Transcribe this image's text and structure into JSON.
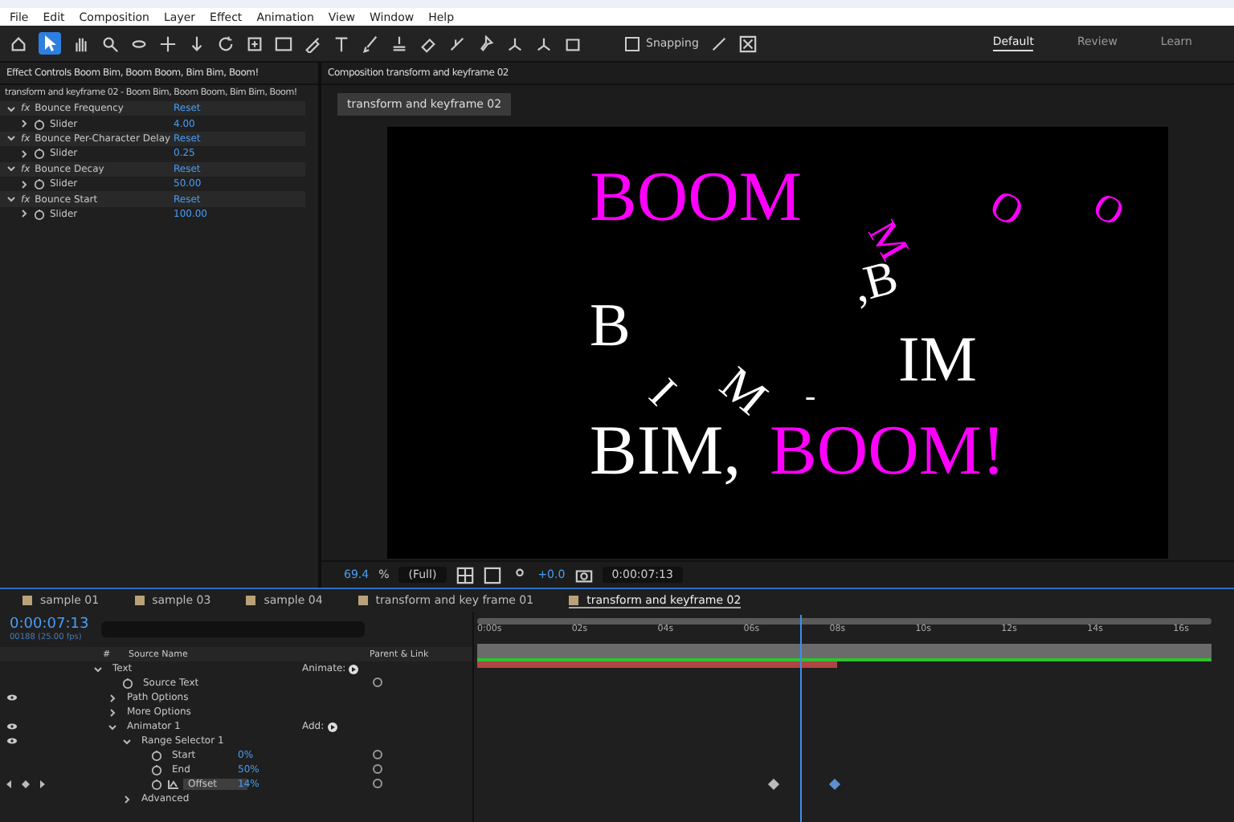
{
  "menu": [
    "File",
    "Edit",
    "Composition",
    "Layer",
    "Effect",
    "Animation",
    "View",
    "Window",
    "Help"
  ],
  "toolbar": {
    "snapping": {
      "label": "Snapping",
      "checked": false
    },
    "workspaces": [
      {
        "label": "Default",
        "selected": true
      },
      {
        "label": "Review",
        "selected": false
      },
      {
        "label": "Learn",
        "selected": false
      }
    ]
  },
  "effect_controls": {
    "tab": "Effect Controls Boom Bim, Boom Boom, Bim Bim, Boom!",
    "subtitle": "transform and keyframe 02 - Boom Bim, Boom Boom, Bim Bim, Boom!",
    "effects": [
      {
        "fx": "fx",
        "name": "Bounce Frequency",
        "reset": "Reset",
        "expanded": true,
        "param": "Slider",
        "value": "4.00"
      },
      {
        "fx": "fx",
        "name": "Bounce Per-Character Delay",
        "reset": "Reset",
        "expanded": true,
        "param": "Slider",
        "value": "0.25"
      },
      {
        "fx": "fx",
        "name": "Bounce Decay",
        "reset": "Reset",
        "expanded": true,
        "param": "Slider",
        "value": "50.00"
      },
      {
        "fx": "fx",
        "name": "Bounce Start",
        "reset": "Reset",
        "expanded": true,
        "param": "Slider",
        "value": "100.00"
      }
    ]
  },
  "composition": {
    "tab": "Composition transform and keyframe 02",
    "breadcrumb": "transform and keyframe 02",
    "glyphs": [
      {
        "text": "BOOM",
        "color": "#ff00ff"
      },
      {
        "text": "O",
        "color": "#ff00ff"
      },
      {
        "text": "O",
        "color": "#ff00ff"
      },
      {
        "text": "M",
        "color": "#ff00ff"
      },
      {
        "text": ",B",
        "color": "#ffffff"
      },
      {
        "text": "B",
        "color": "#ffffff"
      },
      {
        "text": "IM",
        "color": "#ffffff"
      },
      {
        "text": "I",
        "color": "#ffffff"
      },
      {
        "text": "M",
        "color": "#ffffff"
      },
      {
        "text": "-",
        "color": "#ffffff"
      },
      {
        "text": "BIM,",
        "color": "#ffffff"
      },
      {
        "text": "BOOM!",
        "color": "#ff00ff"
      }
    ],
    "zoom": "69.4",
    "zoom_unit": "%",
    "resolution": "(Full)",
    "exposure": "+0.0",
    "timecode": "0:00:07:13"
  },
  "timeline": {
    "tabs": [
      {
        "label": "sample 01",
        "selected": false
      },
      {
        "label": "sample 03",
        "selected": false
      },
      {
        "label": "sample 04",
        "selected": false
      },
      {
        "label": "transform and key frame 01",
        "selected": false
      },
      {
        "label": "transform and keyframe 02",
        "selected": true
      }
    ],
    "timecode": "0:00:07:13",
    "frames": "00188 (25.00 fps)",
    "columns": {
      "source_name": "Source Name",
      "parent": "Parent & Link",
      "number": "#"
    },
    "ruler": [
      "0:00s",
      "02s",
      "04s",
      "06s",
      "08s",
      "10s",
      "12s",
      "14s",
      "16s"
    ],
    "properties": [
      {
        "name": "Text",
        "expanded": true,
        "action": "Animate:",
        "children": [
          {
            "name": "Source Text",
            "stopwatch": true
          },
          {
            "name": "Path Options",
            "expanded": false,
            "eye": true
          },
          {
            "name": "More Options",
            "expanded": false
          },
          {
            "name": "Animator 1",
            "expanded": true,
            "eye": true,
            "action": "Add:",
            "children": [
              {
                "name": "Range Selector 1",
                "expanded": true,
                "eye": true,
                "children": [
                  {
                    "name": "Start",
                    "stopwatch": true,
                    "value": "0%"
                  },
                  {
                    "name": "End",
                    "stopwatch": true,
                    "value": "50%"
                  },
                  {
                    "name": "Offset",
                    "stopwatch": true,
                    "value": "14%",
                    "keyframed": true,
                    "selected": true
                  }
                ]
              },
              {
                "name": "Advanced",
                "expanded": false
              }
            ]
          }
        ]
      }
    ]
  }
}
